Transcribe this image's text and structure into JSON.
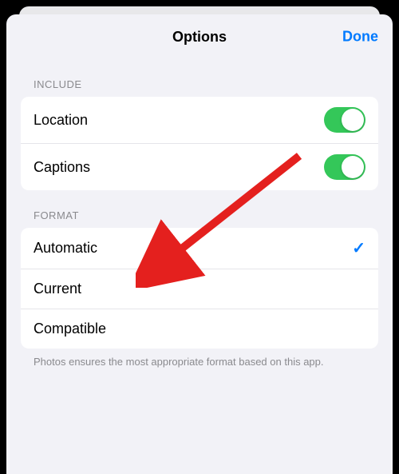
{
  "header": {
    "title": "Options",
    "done_label": "Done"
  },
  "sections": {
    "include": {
      "header": "INCLUDE",
      "rows": [
        {
          "label": "Location",
          "on": true
        },
        {
          "label": "Captions",
          "on": true
        }
      ]
    },
    "format": {
      "header": "FORMAT",
      "rows": [
        {
          "label": "Automatic",
          "selected": true
        },
        {
          "label": "Current",
          "selected": false
        },
        {
          "label": "Compatible",
          "selected": false
        }
      ],
      "footer": "Photos ensures the most appropriate format based on this app."
    }
  },
  "annotation": {
    "arrow_color": "#e4201e"
  }
}
